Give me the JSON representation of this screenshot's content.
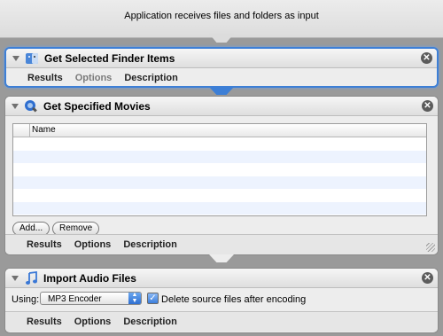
{
  "header": {
    "input_text": "Application receives files and folders as input"
  },
  "actions": [
    {
      "title": "Get Selected Finder Items",
      "icon": "finder-icon",
      "tabs": [
        "Results",
        "Options",
        "Description"
      ]
    },
    {
      "title": "Get Specified Movies",
      "icon": "quicktime-icon",
      "table": {
        "columns": [
          "Name"
        ],
        "rows": []
      },
      "buttons": {
        "add": "Add...",
        "remove": "Remove"
      },
      "tabs": [
        "Results",
        "Options",
        "Description"
      ]
    },
    {
      "title": "Import Audio Files",
      "icon": "music-note-icon",
      "using_label": "Using:",
      "encoder": {
        "selected": "MP3 Encoder"
      },
      "delete_checkbox": {
        "label": "Delete source files after encoding",
        "checked": true
      },
      "tabs": [
        "Results",
        "Options",
        "Description"
      ]
    }
  ],
  "close_glyph": "✕",
  "colors": {
    "selection": "#3d7fd6",
    "background": "#9a9a9a"
  }
}
